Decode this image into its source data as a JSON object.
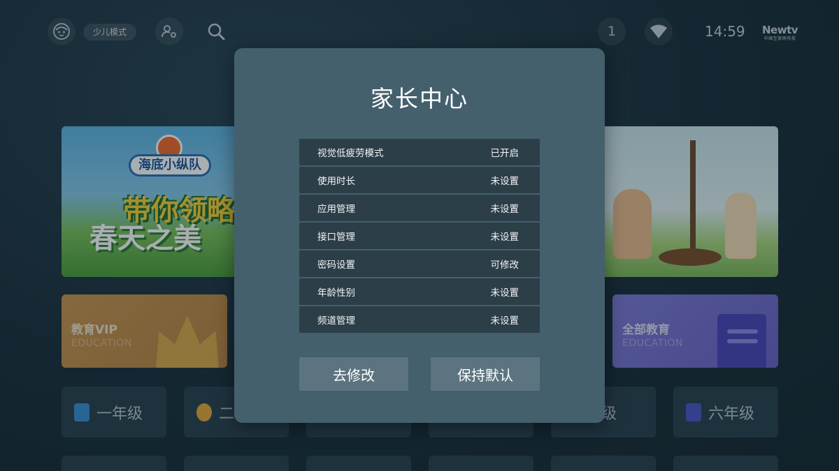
{
  "topbar": {
    "mode_label": "少儿模式",
    "notification_count": "1",
    "time": "14:59",
    "brand_name": "Newtv",
    "brand_sub": "中国互联网电视"
  },
  "banners": {
    "left": {
      "badge": "海底小纵队",
      "title_line1": "带你领略",
      "title_line2": "春天之美"
    }
  },
  "cards": {
    "vip": {
      "title": "教育VIP",
      "subtitle": "EDUCATION"
    },
    "all": {
      "title": "全部教育",
      "subtitle": "EDUCATION"
    }
  },
  "grades": [
    {
      "label": "一年级",
      "icon": "book-icon",
      "color": "#3a8fd6"
    },
    {
      "label": "二",
      "icon": "bulb-icon",
      "color": "#e4a73a"
    },
    {
      "label": "年级",
      "icon": "leaf-icon",
      "color": "#53b35a"
    },
    {
      "label": "六年级",
      "icon": "notebook-icon",
      "color": "#4a56c8"
    }
  ],
  "modal": {
    "title": "家长中心",
    "settings": [
      {
        "label": "视觉低疲劳模式",
        "value": "已开启"
      },
      {
        "label": "使用时长",
        "value": "未设置"
      },
      {
        "label": "应用管理",
        "value": "未设置"
      },
      {
        "label": "接口管理",
        "value": "未设置"
      },
      {
        "label": "密码设置",
        "value": "可修改"
      },
      {
        "label": "年龄性别",
        "value": "未设置"
      },
      {
        "label": "频道管理",
        "value": "未设置"
      }
    ],
    "edit_button": "去修改",
    "keep_button": "保持默认"
  }
}
